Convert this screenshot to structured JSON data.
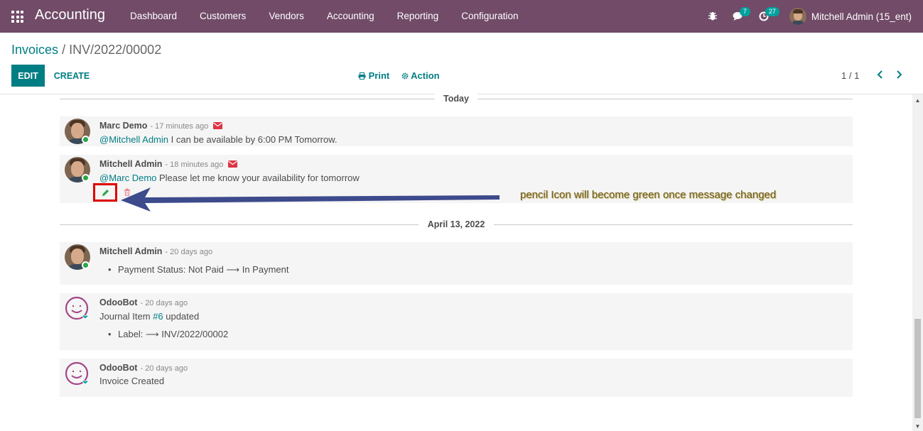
{
  "navbar": {
    "app_name": "Accounting",
    "menu": [
      "Dashboard",
      "Customers",
      "Vendors",
      "Accounting",
      "Reporting",
      "Configuration"
    ],
    "messages_count": "7",
    "activities_count": "27",
    "user": "Mitchell Admin (15_ent)",
    "color": "#714b67"
  },
  "breadcrumb": {
    "parent": "Invoices",
    "separator": "/",
    "current": "INV/2022/00002"
  },
  "controls": {
    "edit_label": "EDIT",
    "create_label": "CREATE",
    "print_label": "Print",
    "action_label": "Action",
    "pager": "1 / 1"
  },
  "chatter": {
    "today_label": "Today",
    "date2_label": "April 13, 2022",
    "messages": [
      {
        "author": "Marc Demo",
        "time": "- 17 minutes ago",
        "mention": "@Mitchell Admin",
        "text": " I can be available by 6:00 PM Tomorrow."
      },
      {
        "author": "Mitchell Admin",
        "time": "- 18 minutes ago",
        "mention": "@Marc Demo",
        "text": " Please let me know your availability for tomorrow"
      },
      {
        "author": "Mitchell Admin",
        "time": "- 20 days ago",
        "tracking": "Payment Status: Not Paid ⟶ In Payment"
      },
      {
        "author": "OdooBot",
        "time": "- 20 days ago",
        "text_prefix": "Journal Item ",
        "link": "#6",
        "text_suffix": " updated",
        "tracking": "Label: ⟶ INV/2022/00002"
      },
      {
        "author": "OdooBot",
        "time": "- 20 days ago",
        "text": "Invoice Created"
      }
    ]
  },
  "annotation": {
    "text": "pencil Icon will become green once  message changed",
    "arrow_color": "#3d4a8c",
    "highlight_color": "#e00000"
  },
  "accent_color": "#017e84",
  "edit_icon_color": "#28a745"
}
